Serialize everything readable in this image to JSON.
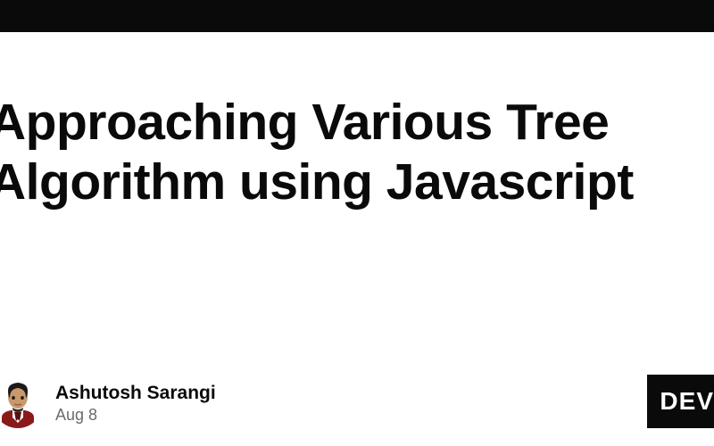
{
  "title_line1": "Approaching Various Tree",
  "title_line2": "Algorithm using Javascript",
  "author": "Ashutosh Sarangi",
  "date": "Aug 8",
  "badge": "DEV"
}
